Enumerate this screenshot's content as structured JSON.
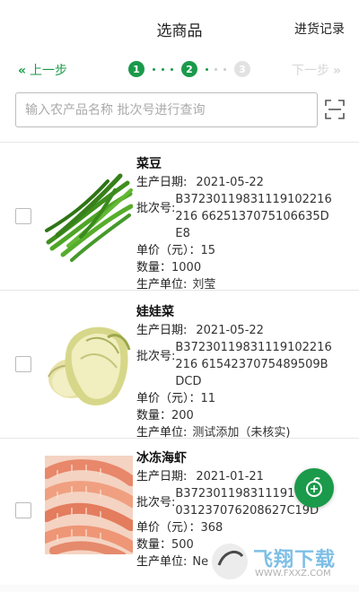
{
  "header": {
    "title": "选商品",
    "history_label": "进货记录"
  },
  "stepper": {
    "prev_label": "上一步",
    "next_label": "下一步",
    "steps": [
      "1",
      "2",
      "3"
    ],
    "current_step": 2
  },
  "search": {
    "placeholder": "输入农产品名称 批次号进行查询",
    "value": ""
  },
  "labels": {
    "date": "生产日期:",
    "batch": "批次号:",
    "price": "单价（元）：",
    "qty": "数量：",
    "unit": "生产单位:"
  },
  "products": [
    {
      "name": "菜豆",
      "date": "2021-05-22",
      "batch": "B37230119831119102216216 6625137075106635DE8",
      "price": "15",
      "qty": "1000",
      "unit": "刘莹",
      "image": "green-beans"
    },
    {
      "name": "娃娃菜",
      "date": "2021-05-22",
      "batch": "B37230119831119102216216 6154237075489509BDCD",
      "price": "11",
      "qty": "200",
      "unit": "测试添加（未核实)",
      "image": "baby-cabbage"
    },
    {
      "name": "冰冻海虾",
      "date": "2021-01-21",
      "batch": "B3723011983111910 15 9031237076208627C19D",
      "price": "368",
      "qty": "500",
      "unit": "Ne",
      "image": "frozen-shrimp"
    }
  ],
  "watermark": {
    "text": "飞翔下载",
    "url": "WWW.FXXZ.COM"
  },
  "colors": {
    "accent": "#1a9a4a",
    "inactive": "#d6d6d6"
  }
}
